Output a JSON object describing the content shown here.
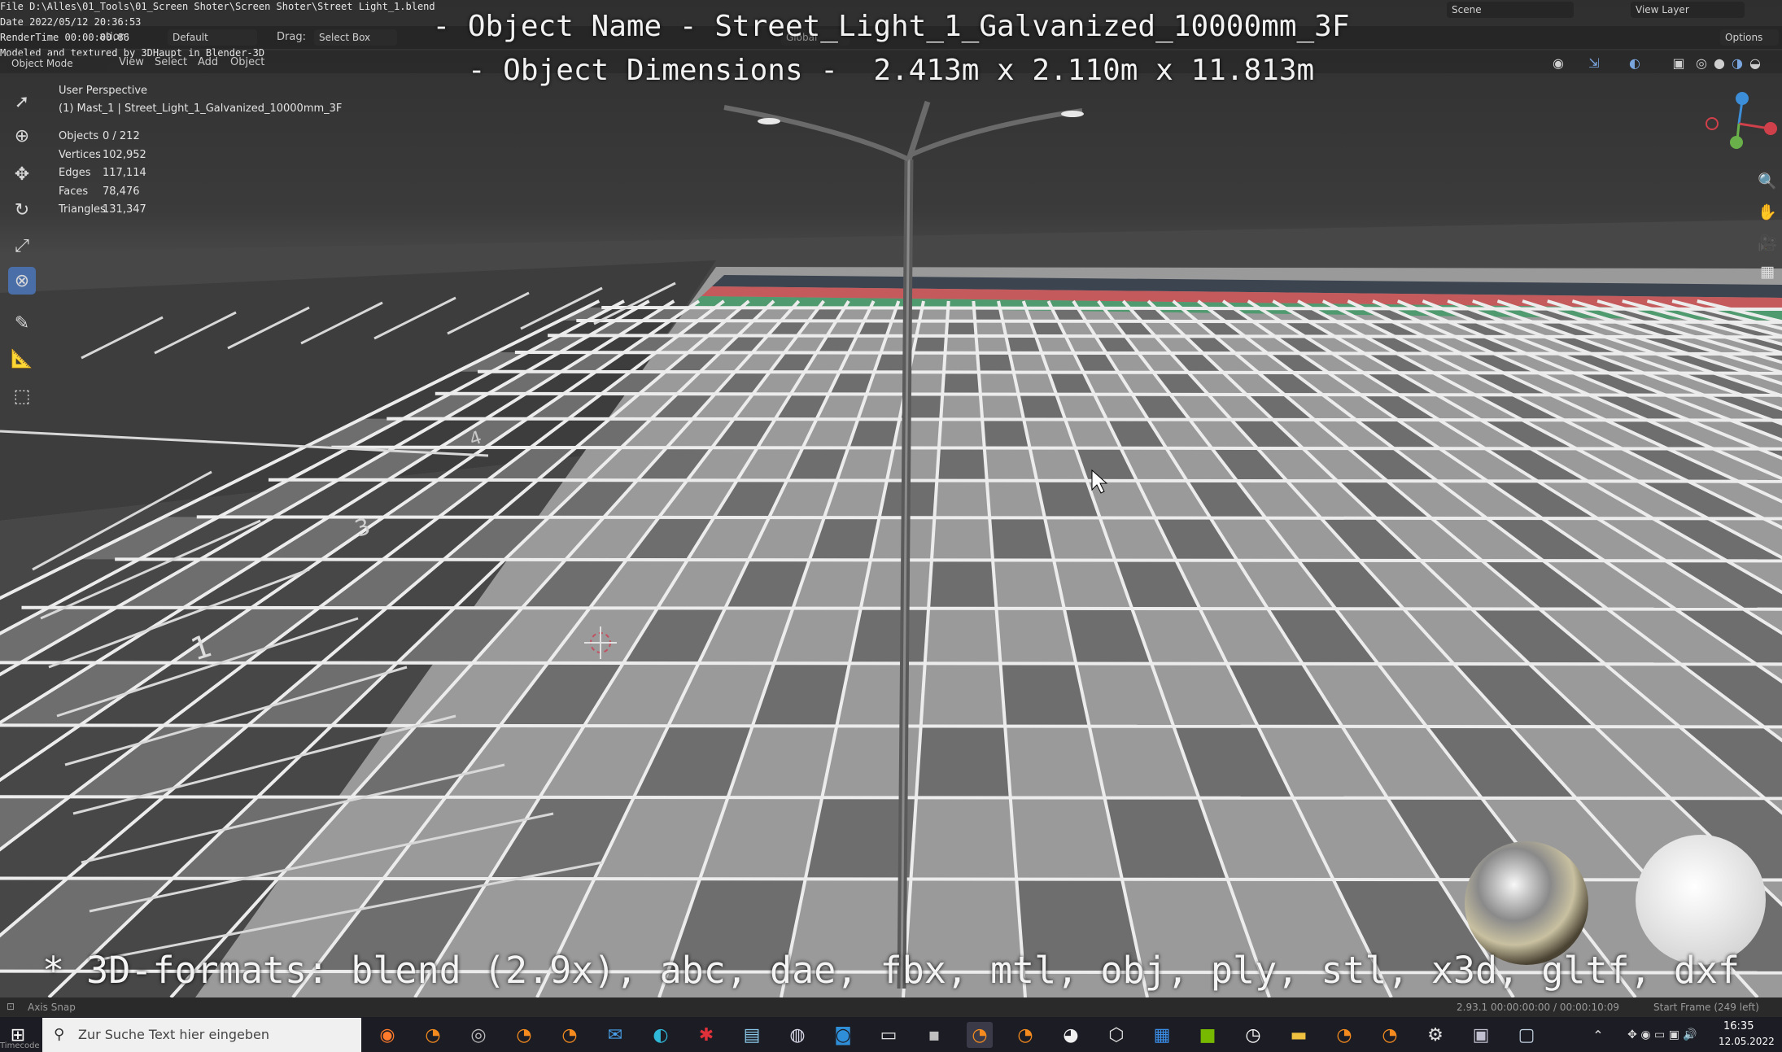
{
  "file_info": {
    "file_path": "File D:\\Alles\\01_Tools\\01_Screen Shoter\\Screen Shoter\\Street Light_1.blend",
    "date": "Date 2022/05/12 20:36:53",
    "render_time": "RenderTime 00:00:00.86",
    "modeled_by": "Modeled and textured by 3DHaupt in Blender-3D"
  },
  "header": {
    "orientation_label": "ation:",
    "orientation_value": "Default",
    "drag_label": "Drag:",
    "drag_value": "Select Box",
    "mode": "Object Mode",
    "menus": [
      "View",
      "Select",
      "Add",
      "Object"
    ],
    "transform_global": "Global",
    "scene": "Scene",
    "view_layer": "View Layer",
    "options": "Options"
  },
  "overlay": {
    "object_name": "- Object Name - Street_Light_1_Galvanized_10000mm_3F",
    "object_dimensions": "- Object Dimensions -  2.413m x 2.110m x 11.813m",
    "formats": "* 3D-formats: blend (2.9x), abc, dae, fbx, mtl, obj, ply, stl, x3d, gltf, dxf"
  },
  "viewport_info": {
    "perspective": "User Perspective",
    "active_object": "(1) Mast_1 | Street_Light_1_Galvanized_10000mm_3F",
    "stats": [
      {
        "label": "Objects",
        "value": "0 / 212"
      },
      {
        "label": "Vertices",
        "value": "102,952"
      },
      {
        "label": "Edges",
        "value": "117,114"
      },
      {
        "label": "Faces",
        "value": "78,476"
      },
      {
        "label": "Triangles",
        "value": "131,347"
      }
    ]
  },
  "statusbar": {
    "axis_snap": "Axis Snap",
    "version_time": "2.93.1  00:00:00:00 / 00:00:10:09",
    "start_frame": "Start Frame (249 left)"
  },
  "taskbar": {
    "search_placeholder": "Zur Suche Text hier eingeben",
    "time": "16:35",
    "date": "12.05.2022",
    "timecode": "Timecode"
  },
  "ground_markings": [
    "1",
    "2",
    "3",
    "4"
  ],
  "colors": {
    "active_tool": "#4a6ea8",
    "axis_x": "#d0404a",
    "axis_y": "#6ab04a",
    "axis_z": "#3c8ed8"
  }
}
